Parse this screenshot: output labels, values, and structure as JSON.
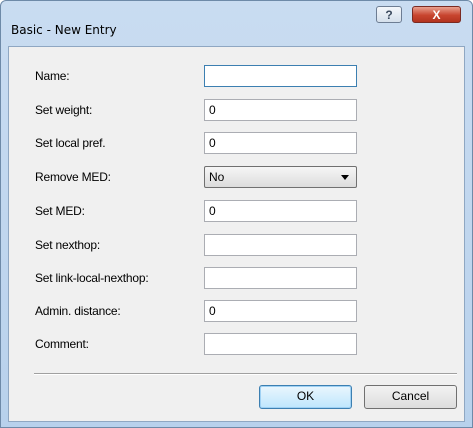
{
  "window": {
    "title": "Basic - New Entry",
    "help_glyph": "?",
    "close_glyph": "X"
  },
  "form": {
    "rows": [
      {
        "label": "Name:",
        "value": ""
      },
      {
        "label": "Set weight:",
        "value": "0"
      },
      {
        "label": "Set local pref.",
        "value": "0"
      },
      {
        "label": "Remove MED:",
        "value": "No"
      },
      {
        "label": "Set MED:",
        "value": "0"
      },
      {
        "label": "Set nexthop:",
        "value": ""
      },
      {
        "label": "Set link-local-nexthop:",
        "value": ""
      },
      {
        "label": "Admin. distance:",
        "value": "0"
      },
      {
        "label": "Comment:",
        "value": ""
      }
    ]
  },
  "buttons": {
    "ok": "OK",
    "cancel": "Cancel"
  }
}
